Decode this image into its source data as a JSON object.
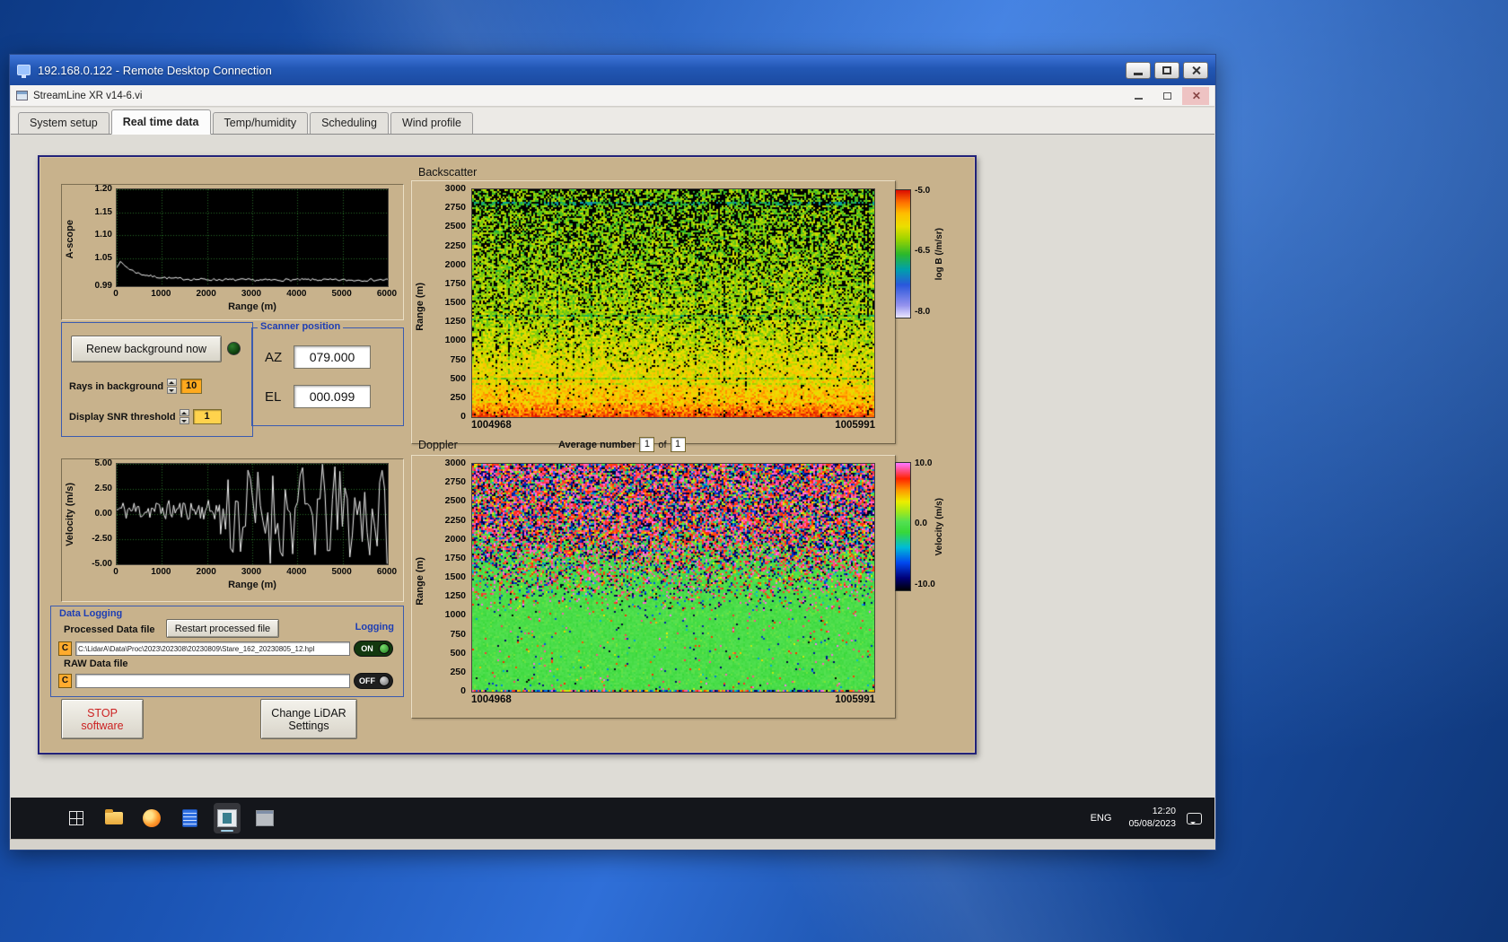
{
  "rdp_window": {
    "title": "192.168.0.122 - Remote Desktop Connection"
  },
  "app_window": {
    "title": "StreamLine XR v14-6.vi",
    "active_tab": "Real time data",
    "tabs": [
      {
        "label": "System setup"
      },
      {
        "label": "Real time data"
      },
      {
        "label": "Temp/humidity"
      },
      {
        "label": "Scheduling"
      },
      {
        "label": "Wind profile"
      }
    ]
  },
  "background_controls": {
    "renew_button": "Renew background now",
    "rays_label": "Rays in background",
    "rays_value": "10",
    "snr_label": "Display SNR threshold",
    "snr_value": "1"
  },
  "scanner_position": {
    "title": "Scanner position",
    "az_label": "AZ",
    "az_value": "079.000",
    "el_label": "EL",
    "el_value": "000.099"
  },
  "averaging": {
    "label": "Average number",
    "current": "1",
    "of_label": "of",
    "total": "1"
  },
  "data_logging": {
    "title": "Data Logging",
    "processed_label": "Processed Data file",
    "restart_button": "Restart processed file",
    "logging_label": "Logging",
    "drive_letter": "C",
    "processed_path": "C:\\LidarA\\Data\\Proc\\2023\\202308\\20230809\\Stare_162_20230805_12.hpl",
    "processed_toggle": "ON",
    "raw_label": "RAW Data file",
    "raw_path": "",
    "raw_toggle": "OFF"
  },
  "action_buttons": {
    "stop_line1": "STOP",
    "stop_line2": "software",
    "change_line1": "Change LiDAR",
    "change_line2": "Settings"
  },
  "taskbar": {
    "language": "ENG",
    "time": "12:20",
    "date": "05/08/2023"
  },
  "chart_data": [
    {
      "id": "ascope",
      "type": "line",
      "ylabel": "A-scope",
      "xlabel": "Range (m)",
      "xlim": [
        0,
        6000
      ],
      "ylim": [
        0.99,
        1.2
      ],
      "xticks": [
        [
          0,
          "0"
        ],
        [
          1000,
          "1000"
        ],
        [
          2000,
          "2000"
        ],
        [
          3000,
          "3000"
        ],
        [
          4000,
          "4000"
        ],
        [
          5000,
          "5000"
        ],
        [
          6000,
          "6000"
        ]
      ],
      "yticks": [
        [
          1.2,
          "1.20"
        ],
        [
          1.15,
          "1.15"
        ],
        [
          1.1,
          "1.10"
        ],
        [
          1.05,
          "1.05"
        ],
        [
          0.99,
          "0.99"
        ]
      ],
      "grid": true,
      "line_color": "#f0f0f0",
      "series": [
        {
          "name": "backscatter amplitude",
          "seed": 7,
          "noise": 0.0028,
          "trend": [
            [
              0,
              1.034
            ],
            [
              90,
              1.042
            ],
            [
              160,
              1.036
            ],
            [
              300,
              1.026
            ],
            [
              500,
              1.017
            ],
            [
              800,
              1.011
            ],
            [
              1200,
              1.007
            ],
            [
              1700,
              1.005
            ],
            [
              2400,
              1.004
            ],
            [
              3200,
              1.003
            ],
            [
              4200,
              1.004
            ],
            [
              5200,
              1.003
            ],
            [
              6000,
              1.004
            ]
          ]
        }
      ]
    },
    {
      "id": "backscatter",
      "type": "heatmap",
      "title": "Backscatter",
      "ylabel": "Range (m)",
      "ylim": [
        0,
        3000
      ],
      "yticks": [
        "3000",
        "2750",
        "2500",
        "2250",
        "2000",
        "1750",
        "1500",
        "1250",
        "1000",
        "750",
        "500",
        "250",
        "0"
      ],
      "x_ticks": [
        "1004968",
        "1005991"
      ],
      "value_label": "log B (/m/sr)",
      "value_range": [
        -8.0,
        -5.0
      ],
      "colorbar_ticks": [
        "-5.0",
        "-6.5",
        "-8.0"
      ],
      "noise": 0.3,
      "dropout": {
        "start": 500,
        "full": 3400,
        "max": 0.5
      },
      "seed": 5,
      "profile": [
        [
          0,
          -5.05
        ],
        [
          70,
          -5.3
        ],
        [
          220,
          -5.55
        ],
        [
          450,
          -5.72
        ],
        [
          800,
          -5.92
        ],
        [
          1200,
          -6.05
        ],
        [
          1700,
          -6.15
        ],
        [
          2300,
          -6.2
        ],
        [
          3000,
          -6.25
        ]
      ],
      "colormap": [
        [
          0,
          "#efeaff"
        ],
        [
          0.1,
          "#9492ee"
        ],
        [
          0.26,
          "#2a58dc"
        ],
        [
          0.38,
          "#00a0ac"
        ],
        [
          0.5,
          "#2cb82c"
        ],
        [
          0.62,
          "#9ed400"
        ],
        [
          0.72,
          "#ecdf00"
        ],
        [
          0.82,
          "#ffbe00"
        ],
        [
          0.91,
          "#ff6f00"
        ],
        [
          1,
          "#dd1000"
        ]
      ]
    },
    {
      "id": "velocity",
      "type": "line",
      "ylabel": "Velocity (m/s)",
      "xlabel": "Range (m)",
      "xlim": [
        0,
        6000
      ],
      "ylim": [
        -5,
        5
      ],
      "xticks": [
        [
          0,
          "0"
        ],
        [
          1000,
          "1000"
        ],
        [
          2000,
          "2000"
        ],
        [
          3000,
          "3000"
        ],
        [
          4000,
          "4000"
        ],
        [
          5000,
          "5000"
        ],
        [
          6000,
          "6000"
        ]
      ],
      "yticks": [
        [
          5,
          "5.00"
        ],
        [
          2.5,
          "2.50"
        ],
        [
          0,
          "0.00"
        ],
        [
          -2.5,
          "-2.50"
        ],
        [
          -5,
          "-5.00"
        ]
      ],
      "grid": true,
      "line_color": "#f0f0f0",
      "series": [
        {
          "name": "radial velocity",
          "seed": 11,
          "segments": [
            {
              "x0": 0,
              "x1": 2300,
              "mean": 0.4,
              "noise": 1.0,
              "step": 35
            },
            {
              "x0": 2300,
              "x1": 6000,
              "mean": 0,
              "noise": 5.0,
              "step": 55
            }
          ]
        }
      ]
    },
    {
      "id": "doppler",
      "type": "heatmap",
      "title": "Doppler",
      "ylabel": "Range (m)",
      "ylim": [
        0,
        3000
      ],
      "yticks": [
        "3000",
        "2750",
        "2500",
        "2250",
        "2000",
        "1750",
        "1500",
        "1250",
        "1000",
        "750",
        "500",
        "250",
        "0"
      ],
      "x_ticks": [
        "1004968",
        "1005991"
      ],
      "value_label": "Velocity (m/s)",
      "value_range": [
        -10,
        10
      ],
      "colorbar_ticks": [
        "10.0",
        "0.0",
        "-10.0"
      ],
      "seed": 9,
      "signal": {
        "mean": 0.3,
        "sd": 1.0
      },
      "noise_onset": 1050,
      "noise_full": 2150,
      "colormap": [
        [
          0,
          "#000000"
        ],
        [
          0.1,
          "#000078"
        ],
        [
          0.22,
          "#0048f0"
        ],
        [
          0.34,
          "#00bcd8"
        ],
        [
          0.46,
          "#38d838"
        ],
        [
          0.54,
          "#52e052"
        ],
        [
          0.62,
          "#a2e81c"
        ],
        [
          0.7,
          "#eeee00"
        ],
        [
          0.79,
          "#ff9800"
        ],
        [
          0.88,
          "#ff2400"
        ],
        [
          1,
          "#ff74ff"
        ]
      ]
    }
  ]
}
